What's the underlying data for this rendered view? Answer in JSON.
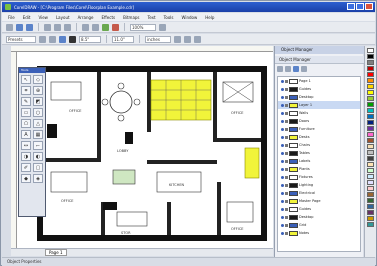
{
  "window": {
    "title": "CorelDRAW - [C:\\Program Files\\Corel\\Floorplan Example.cdr]"
  },
  "menu": [
    "File",
    "Edit",
    "View",
    "Layout",
    "Arrange",
    "Effects",
    "Bitmaps",
    "Text",
    "Tools",
    "Window",
    "Help"
  ],
  "toolbar": {
    "zoom_value": "100%",
    "preset_field": "Presets",
    "width_field": "8.5\"",
    "height_field": "11.0\"",
    "units_field": "inches"
  },
  "toolbox": {
    "title": "Tools"
  },
  "canvas": {
    "room_labels": [
      "OFFICE",
      "OFFICE",
      "OFFICE",
      "LOBBY",
      "KITCHEN",
      "OFFICE",
      "STOR"
    ],
    "highlight_color": "#f1f43a"
  },
  "page_tabs": [
    "Page 1"
  ],
  "status": {
    "text": "Object Properties"
  },
  "docker": {
    "tab_label": "Object Manager",
    "title": "Object Manager",
    "layers": [
      {
        "name": "Page 1",
        "selected": false
      },
      {
        "name": "Guides",
        "selected": false
      },
      {
        "name": "Desktop",
        "selected": false
      },
      {
        "name": "Layer 1",
        "selected": true
      },
      {
        "name": "Walls",
        "selected": false
      },
      {
        "name": "Doors",
        "selected": false
      },
      {
        "name": "Furniture",
        "selected": false
      },
      {
        "name": "Desks",
        "selected": false
      },
      {
        "name": "Chairs",
        "selected": false
      },
      {
        "name": "Tables",
        "selected": false
      },
      {
        "name": "Labels",
        "selected": false
      },
      {
        "name": "Plants",
        "selected": false
      },
      {
        "name": "Fixtures",
        "selected": false
      },
      {
        "name": "Lighting",
        "selected": false
      },
      {
        "name": "Electrical",
        "selected": false
      },
      {
        "name": "Master Page",
        "selected": false
      },
      {
        "name": "Guides",
        "selected": false
      },
      {
        "name": "Desktop",
        "selected": false
      },
      {
        "name": "Grid",
        "selected": false
      },
      {
        "name": "Notes",
        "selected": false
      }
    ]
  },
  "palette_colors": [
    "#ffffff",
    "#000000",
    "#7f7f7f",
    "#c00000",
    "#ff0000",
    "#ff8c00",
    "#ffd700",
    "#ffff00",
    "#9acd32",
    "#00a000",
    "#00c0c0",
    "#0070c0",
    "#002080",
    "#7030a0",
    "#ff66cc",
    "#a0522d",
    "#f5deb3",
    "#c0c0c0",
    "#404040",
    "#ffe4b5",
    "#ccffcc",
    "#ccecff",
    "#e0e0ff",
    "#ffcccc",
    "#996633",
    "#336633",
    "#336699",
    "#663366",
    "#cc9900",
    "#339999"
  ]
}
